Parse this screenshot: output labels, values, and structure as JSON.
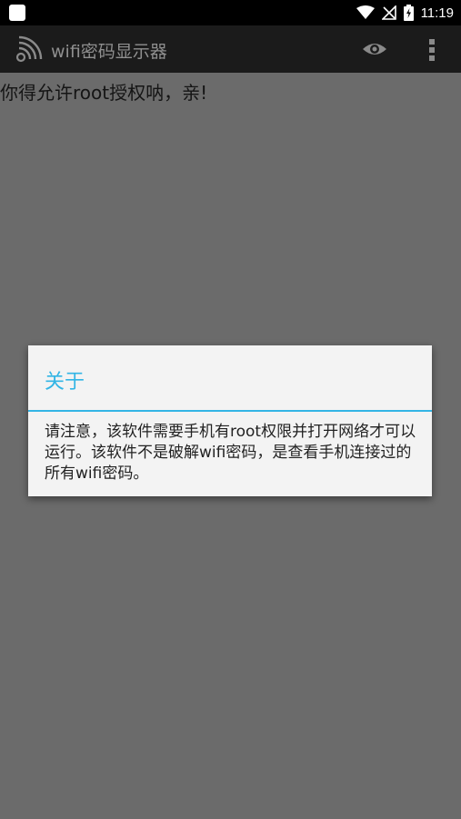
{
  "status_bar": {
    "time": "11:19",
    "icons": [
      "notification-square-icon",
      "wifi-icon",
      "no-signal-icon",
      "battery-charging-icon"
    ]
  },
  "app_bar": {
    "title": "wifi密码显示器",
    "icons": [
      "wifi-logo-icon",
      "eye-icon",
      "overflow-menu-icon"
    ]
  },
  "content": {
    "message": "你得允许root授权呐，亲!"
  },
  "dialog": {
    "title": "关于",
    "message": "请注意，该软件需要手机有root权限并打开网络才可以运行。该软件不是破解wifi密码，是查看手机连接过的所有wifi密码。"
  },
  "colors": {
    "accent": "#33b5e5",
    "background_dim": "#6b6b6b",
    "dialog_bg": "#f3f3f3"
  }
}
